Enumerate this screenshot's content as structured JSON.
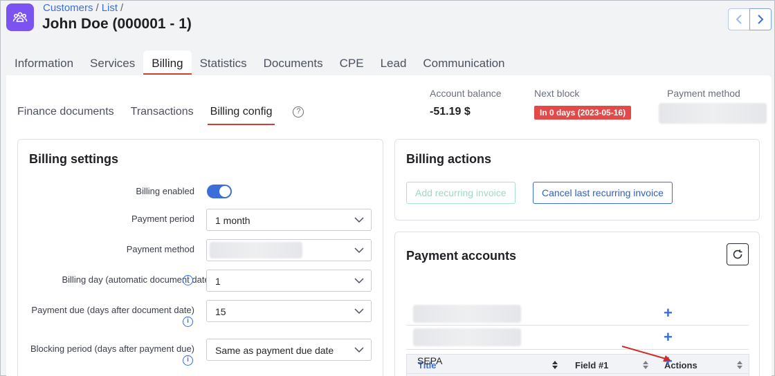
{
  "header": {
    "breadcrumb": [
      "Customers",
      "List"
    ],
    "title": "John Doe (000001 - 1)"
  },
  "tabs": [
    "Information",
    "Services",
    "Billing",
    "Statistics",
    "Documents",
    "CPE",
    "Lead",
    "Communication"
  ],
  "subtabs": [
    "Finance documents",
    "Transactions",
    "Billing config"
  ],
  "stats": {
    "balance_label": "Account balance",
    "balance_value": "-51.19 $",
    "next_block_label": "Next block",
    "next_block_value": "In 0 days (2023-05-16)",
    "payment_method_label": "Payment method"
  },
  "billing_settings": {
    "title": "Billing settings",
    "billing_enabled_label": "Billing enabled",
    "payment_period_label": "Payment period",
    "payment_period_value": "1 month",
    "payment_method_label": "Payment method",
    "billing_day_label": "Billing day (automatic document date)",
    "billing_day_value": "1",
    "payment_due_label": "Payment due (days after document date)",
    "payment_due_value": "15",
    "blocking_period_label": "Blocking period (days after payment due)",
    "blocking_period_value": "Same as payment due date"
  },
  "billing_actions": {
    "title": "Billing actions",
    "add_recurring": "Add recurring invoice",
    "cancel_recurring": "Cancel last recurring invoice"
  },
  "payment_accounts": {
    "title": "Payment accounts",
    "columns": [
      "Title",
      "Field #1",
      "Actions"
    ],
    "rows": [
      "",
      "",
      "SEPA"
    ]
  },
  "colors": {
    "accent": "#3b6ed8",
    "brand": "#7b53f0",
    "danger": "#e24a4a"
  }
}
